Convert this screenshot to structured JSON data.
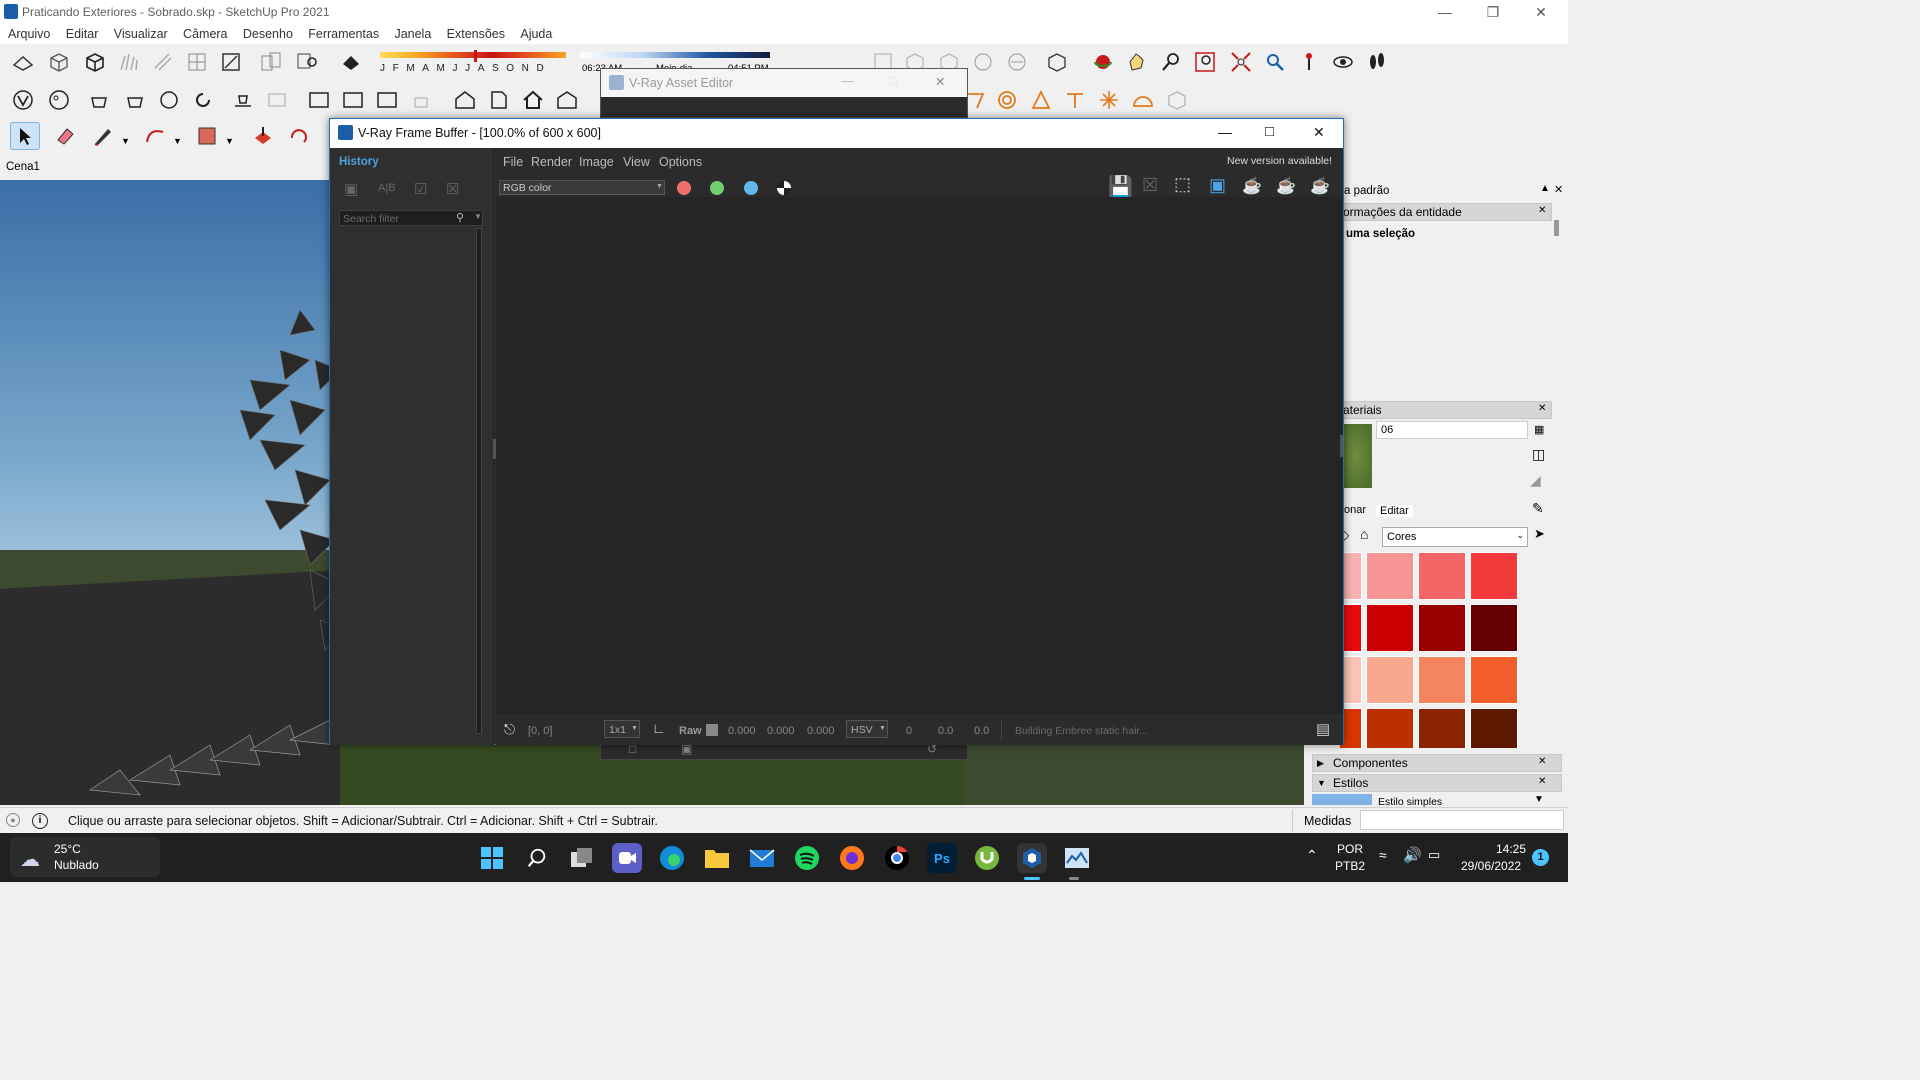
{
  "window": {
    "title": "Praticando Exteriores - Sobrado.skp - SketchUp Pro 2021"
  },
  "menu": [
    "Arquivo",
    "Editar",
    "Visualizar",
    "Câmera",
    "Desenho",
    "Ferramentas",
    "Janela",
    "Extensões",
    "Ajuda"
  ],
  "shadow_bar": {
    "months": [
      "J",
      "F",
      "M",
      "A",
      "M",
      "J",
      "J",
      "A",
      "S",
      "O",
      "N",
      "D"
    ],
    "time_start": "06:23 AM",
    "time_mid": "Meio-dia",
    "time_end": "04:51 PM"
  },
  "scene_tab": "Cena1",
  "asset_editor": {
    "title": "V-Ray Asset Editor"
  },
  "frame_buffer": {
    "title": "V-Ray Frame Buffer - [100.0% of 600 x 600]",
    "history_label": "History",
    "search_placeholder": "Search filter",
    "menu": [
      "File",
      "Render",
      "Image",
      "View",
      "Options"
    ],
    "new_version": "New version available!",
    "channel": "RGB color",
    "bottom": {
      "coords": "[0, 0]",
      "sampling": "1x1",
      "raw_label": "Raw",
      "raw_r": "0.000",
      "raw_g": "0.000",
      "raw_b": "0.000",
      "color_mode": "HSV",
      "h": "0",
      "s": "0.0",
      "v": "0.0",
      "status": "Building Embree static hair..."
    }
  },
  "right_panel": {
    "default_tray": "a padrão",
    "entity_info": "ormações da entidade",
    "no_selection": "uma seleção",
    "materials": "ateriais",
    "material_name": "06",
    "tab_select": "onar",
    "tab_edit": "Editar",
    "library": "Cores",
    "components": "Componentes",
    "styles": "Estilos",
    "style_name": "Estilo simples",
    "swatch_colors": [
      "#f8b0b0",
      "#f79494",
      "#f56565",
      "#f23a3a",
      "#e80a0a",
      "#cc0000",
      "#990000",
      "#660000",
      "#f8c4b4",
      "#f7a88e",
      "#f4855e",
      "#f25d2c",
      "#d93500",
      "#bb2f00",
      "#8a2400",
      "#5c1800"
    ]
  },
  "status": {
    "hint": "Clique ou arraste para selecionar objetos. Shift = Adicionar/Subtrair. Ctrl = Adicionar. Shift + Ctrl = Subtrair.",
    "measures": "Medidas"
  },
  "taskbar": {
    "weather_temp": "25°C",
    "weather_desc": "Nublado",
    "lang": "POR",
    "layout": "PTB2",
    "time": "14:25",
    "date": "29/06/2022",
    "notif": "1"
  }
}
